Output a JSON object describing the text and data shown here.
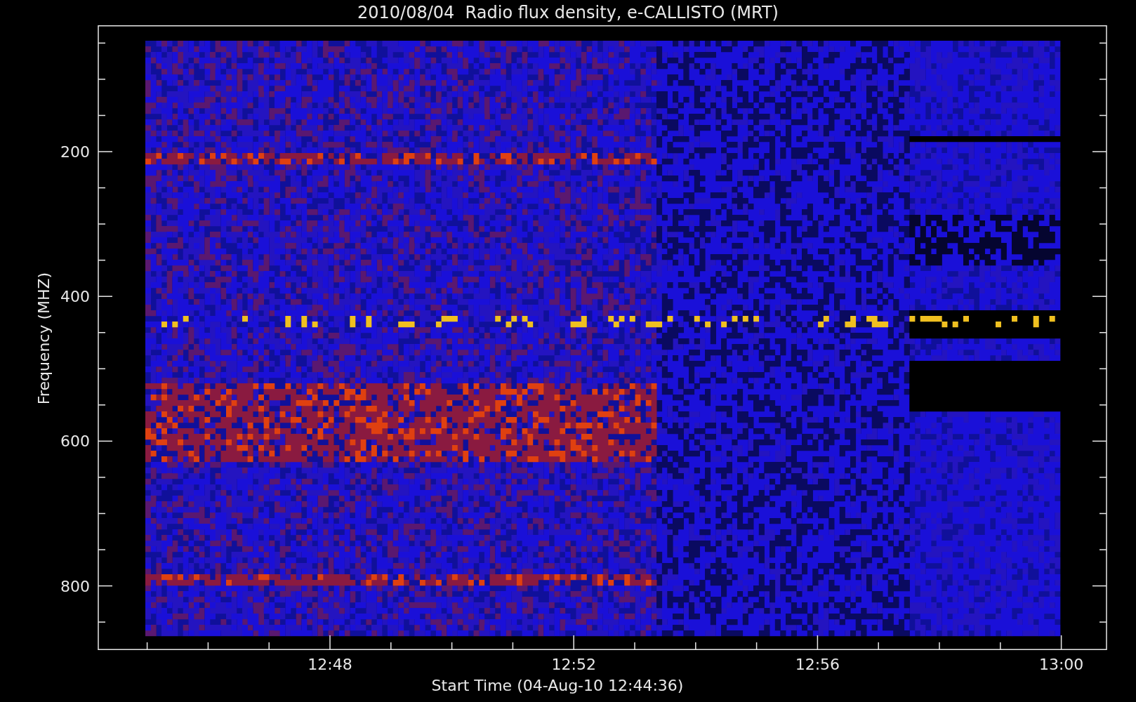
{
  "title": "2010/08/04  Radio flux density, e-CALLISTO (MRT)",
  "plot": {
    "ylabel": "Frequency (MHZ)",
    "yticks": [
      "200",
      "400",
      "600",
      "800"
    ],
    "xticks": [
      "12:48",
      "12:52",
      "12:56",
      "13:00"
    ],
    "xlabel": "Start Time (04-Aug-10 12:44:36)"
  }
}
